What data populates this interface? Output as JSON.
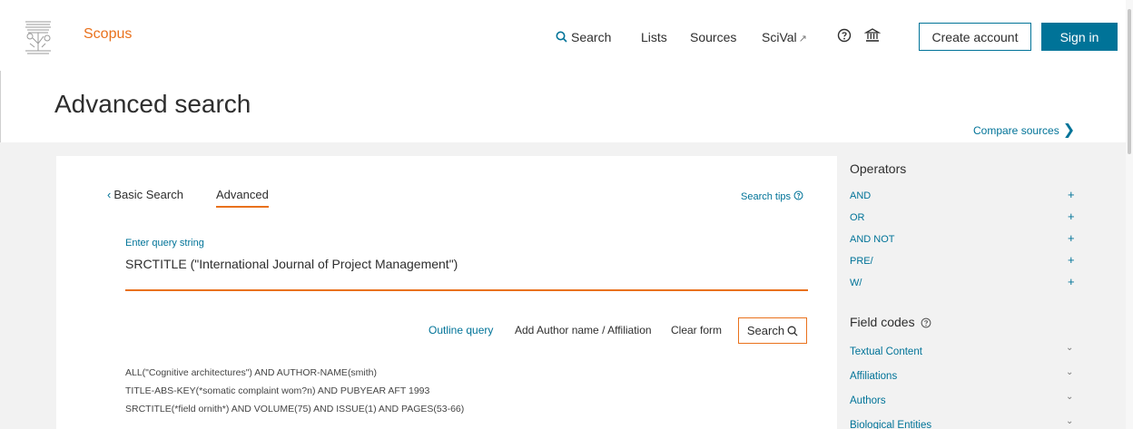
{
  "header": {
    "brand": "Scopus",
    "nav": {
      "search_label": "Search",
      "lists_label": "Lists",
      "sources_label": "Sources",
      "scival_label": "SciVal",
      "scival_arrow": "↗"
    },
    "create_account_label": "Create account",
    "sign_in_label": "Sign in",
    "icons": {
      "search": "search-icon",
      "help": "help-icon",
      "institution": "institution-icon"
    }
  },
  "page": {
    "title": "Advanced search",
    "compare_sources": "Compare sources",
    "compare_chevron": "❯"
  },
  "tabs": {
    "basic_label": "Basic Search",
    "basic_chevron": "‹",
    "advanced_label": "Advanced",
    "search_tips": "Search tips"
  },
  "query": {
    "label": "Enter query string",
    "value": "SRCTITLE (\"International Journal of Project Management\")"
  },
  "actions": {
    "outline": "Outline query",
    "add_author": "Add Author name / Affiliation",
    "clear": "Clear form",
    "search": "Search"
  },
  "examples": [
    "ALL(\"Cognitive architectures\") AND AUTHOR-NAME(smith)",
    "TITLE-ABS-KEY(*somatic complaint wom?n) AND PUBYEAR AFT 1993",
    "SRCTITLE(*field ornith*) AND VOLUME(75) AND ISSUE(1) AND PAGES(53-66)"
  ],
  "sidebar": {
    "operators_title": "Operators",
    "operators": [
      "AND",
      "OR",
      "AND NOT",
      "PRE/",
      "W/"
    ],
    "plus": "+",
    "field_codes_title": "Field codes",
    "field_codes": [
      "Textual Content",
      "Affiliations",
      "Authors",
      "Biological Entities"
    ],
    "chevron": "⌄"
  },
  "colors": {
    "accent": "#e9711c",
    "link": "#007398",
    "background_panel": "#f2f2f2"
  }
}
